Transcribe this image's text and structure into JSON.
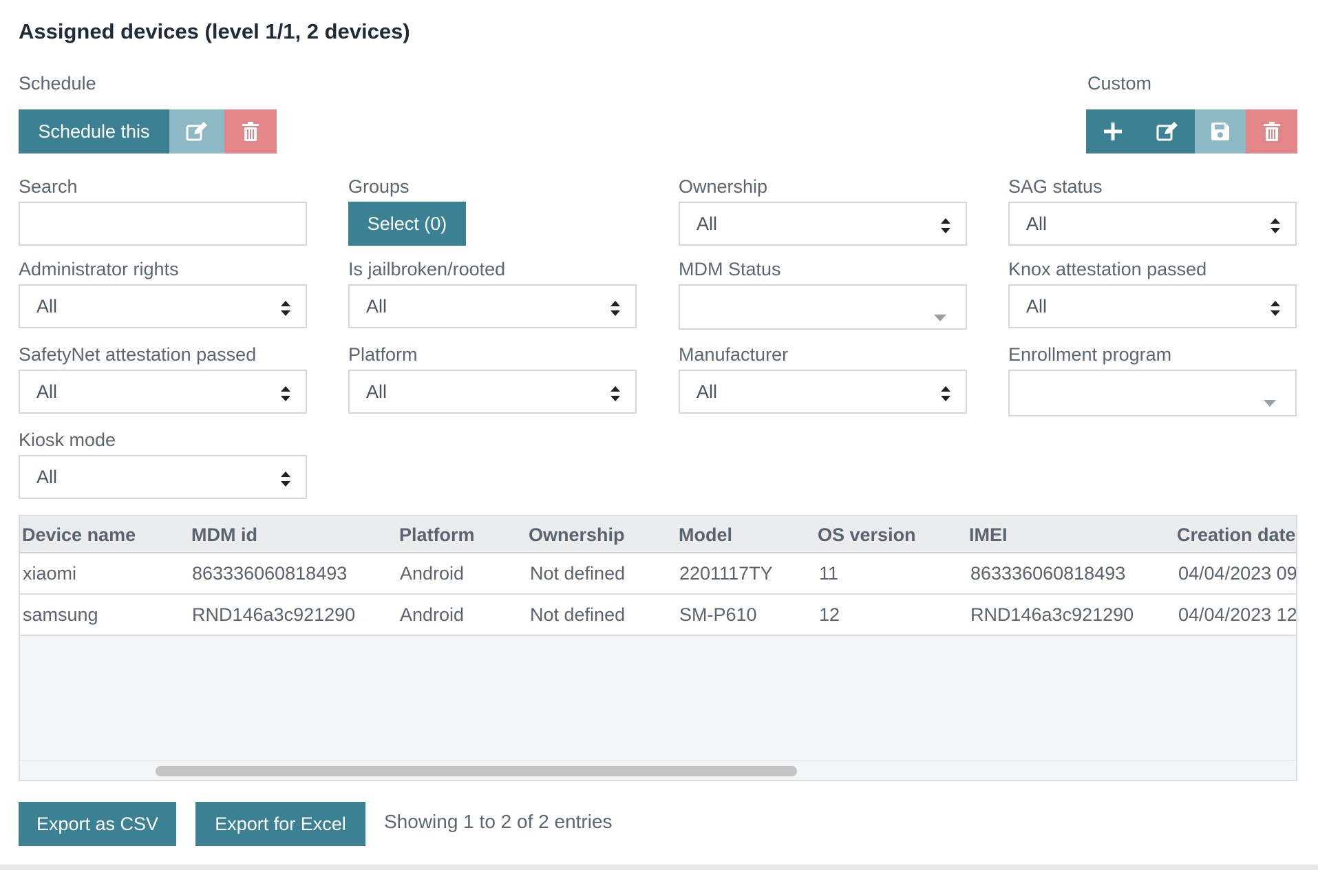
{
  "title": "Assigned devices (level 1/1, 2 devices)",
  "schedule": {
    "label": "Schedule",
    "schedule_button": "Schedule this",
    "edit_icon": "edit-icon",
    "delete_icon": "trash-icon"
  },
  "custom": {
    "label": "Custom",
    "icons": [
      "plus-icon",
      "edit-icon",
      "save-icon",
      "trash-icon"
    ]
  },
  "filters": {
    "search": {
      "label": "Search",
      "value": "",
      "placeholder": ""
    },
    "groups": {
      "label": "Groups",
      "button": "Select (0)"
    },
    "ownership": {
      "label": "Ownership",
      "value": "All"
    },
    "sag_status": {
      "label": "SAG status",
      "value": "All"
    },
    "admin_rights": {
      "label": "Administrator rights",
      "value": "All"
    },
    "jailbroken": {
      "label": "Is jailbroken/rooted",
      "value": "All"
    },
    "mdm_status": {
      "label": "MDM Status",
      "value": ""
    },
    "knox": {
      "label": "Knox attestation passed",
      "value": "All"
    },
    "safetynet": {
      "label": "SafetyNet attestation passed",
      "value": "All"
    },
    "platform": {
      "label": "Platform",
      "value": "All"
    },
    "manufacturer": {
      "label": "Manufacturer",
      "value": "All"
    },
    "enrollment": {
      "label": "Enrollment program",
      "value": ""
    },
    "kiosk": {
      "label": "Kiosk mode",
      "value": "All"
    }
  },
  "table": {
    "headers": [
      "Device name",
      "MDM id",
      "Platform",
      "Ownership",
      "Model",
      "OS version",
      "IMEI",
      "Creation date"
    ],
    "rows": [
      [
        "xiaomi",
        "863336060818493",
        "Android",
        "Not defined",
        "2201117TY",
        "11",
        "863336060818493",
        "04/04/2023 09"
      ],
      [
        "samsung",
        "RND146a3c921290",
        "Android",
        "Not defined",
        "SM-P610",
        "12",
        "RND146a3c921290",
        "04/04/2023 12"
      ]
    ]
  },
  "footer": {
    "export_csv": "Export as CSV",
    "export_excel": "Export for Excel",
    "status": "Showing 1 to 2 of 2 entries"
  },
  "colors": {
    "primary": "#3b8193",
    "primary_light": "#8cb9c3",
    "danger_light": "#e38689"
  }
}
